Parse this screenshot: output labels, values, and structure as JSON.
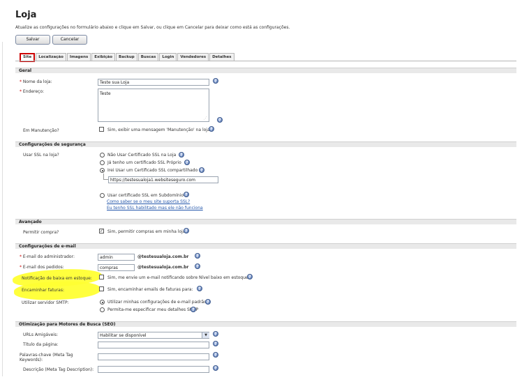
{
  "header": {
    "title": "Loja",
    "intro": "Atualize as configurações no formulário abaixo e clique em Salvar, ou clique em Cancelar para deixar como está as configurações.",
    "save_label": "Salvar",
    "cancel_label": "Cancelar"
  },
  "tabs": [
    "Site",
    "Localização",
    "Imagens",
    "Exibição",
    "Backup",
    "Buscas",
    "Login",
    "Vendedores",
    "Detalhes"
  ],
  "geral": {
    "title": "Geral",
    "store_name_label": "Nome da loja:",
    "store_name_value": "Teste sua Loja",
    "address_label": "Endereço:",
    "address_value": "Teste",
    "maintenance_label": "Em Manutenção?",
    "maintenance_option": "Sim, exibir uma mensagem 'Manutenção' na loja"
  },
  "security": {
    "title": "Configurações de segurança",
    "ssl_label": "Usar SSL na loja?",
    "opt_none": "Não Usar Certificado SSL na Loja",
    "opt_own": "Já tenho um certificado SSL Próprio",
    "opt_shared": "Irei Usar um Certificado SSL compartilhado",
    "shared_url": "https://testesualoja1.websiteseguro.com",
    "opt_subdomain": "Usar certificado SSL em Subdomínio",
    "link_check": "Como saber se o meu site suporta SSL?",
    "link_enabled": "Eu tenho SSL habilitado mas ele não funciona"
  },
  "advanced": {
    "title": "Avançado",
    "allow_label": "Permitir compra?",
    "allow_option": "Sim, permitir compras em minha loja"
  },
  "email": {
    "title": "Configurações de e-mail",
    "admin_label": "E-mail do administrador:",
    "admin_value": "admin",
    "admin_domain": "@testesualoja.com.br",
    "orders_label": "E-mail dos pedidos:",
    "orders_value": "compras",
    "orders_domain": "@testesualoja.com.br",
    "lowstock_label": "Notificação de baixa em estoque:",
    "lowstock_option": "Sim, me envie um e-mail notificando sobre Nível baixo em estoque",
    "invoice_label": "Encaminhar faturas:",
    "invoice_option": "Sim, encaminhar emails de faturas para:",
    "smtp_label": "Utilizar servidor SMTP:",
    "smtp_default": "Utilizar minhas configurações de e-mail padrão",
    "smtp_custom": "Permita-me especificar meu detalhes SMTP"
  },
  "seo": {
    "title": "Otimização para Motores de Busca (SEO)",
    "friendly_label": "URLs Amigáveis:",
    "friendly_value": "Habilitar se disponível",
    "page_title_label": "Título da página:",
    "keywords_label": "Palavras-chave (Meta Tag Keywords):",
    "description_label": "Descrição (Meta Tag Description):"
  },
  "colors": {
    "active_tab_border": "#cc0000",
    "highlight": "#ffff33",
    "help_icon": "#4d6ea8",
    "link": "#2255aa"
  }
}
